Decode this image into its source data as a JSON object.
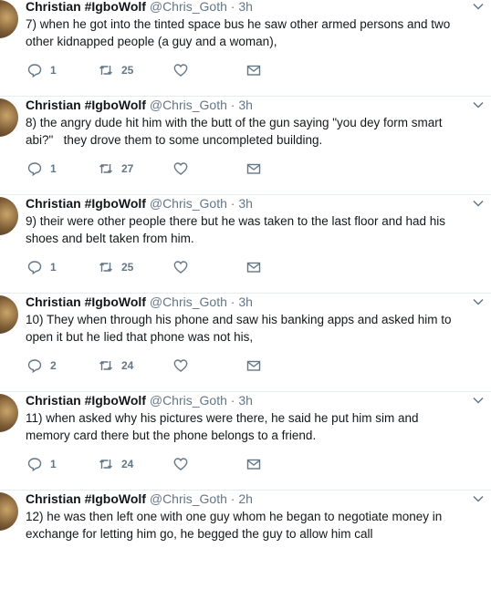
{
  "tweets": [
    {
      "name": "Christian #IgboWolf",
      "handle": "@Chris_Goth",
      "sep": "·",
      "time": "3h",
      "text": "7) when he got into the tinted space bus he saw other armed persons and two other kidnapped people (a guy and a woman),",
      "replies": "1",
      "retweets": "25"
    },
    {
      "name": "Christian #IgboWolf",
      "handle": "@Chris_Goth",
      "sep": "·",
      "time": "3h",
      "text": "8) the angry dude hit him with the butt of the gun saying \"you dey form smart abi?\"   they drove them to some uncompleted building.",
      "replies": "1",
      "retweets": "27"
    },
    {
      "name": "Christian #IgboWolf",
      "handle": "@Chris_Goth",
      "sep": "·",
      "time": "3h",
      "text": "9) their were other people there but he was taken to the last floor and had his shoes and belt taken from him.",
      "replies": "1",
      "retweets": "25"
    },
    {
      "name": "Christian #IgboWolf",
      "handle": "@Chris_Goth",
      "sep": "·",
      "time": "3h",
      "text": "10) They when through his phone and saw his banking apps and asked him to open it but he lied that phone was not his,",
      "replies": "2",
      "retweets": "24"
    },
    {
      "name": "Christian #IgboWolf",
      "handle": "@Chris_Goth",
      "sep": "·",
      "time": "3h",
      "text": "11) when asked why his pictures were there, he said he put him sim and memory card there but the phone belongs to a friend.",
      "replies": "1",
      "retweets": "24"
    },
    {
      "name": "Christian #IgboWolf",
      "handle": "@Chris_Goth",
      "sep": "·",
      "time": "2h",
      "text": "12) he was then left one with one guy whom he began to negotiate money in exchange for letting him go, he begged the guy to allow him call",
      "replies": "",
      "retweets": ""
    }
  ],
  "icons": {
    "reply": "reply-icon",
    "retweet": "retweet-icon",
    "like": "heart-icon",
    "dm": "envelope-icon",
    "caret": "chevron-down-icon"
  },
  "colors": {
    "text": "#14171a",
    "muted": "#657786",
    "border": "#e6ecf0"
  }
}
